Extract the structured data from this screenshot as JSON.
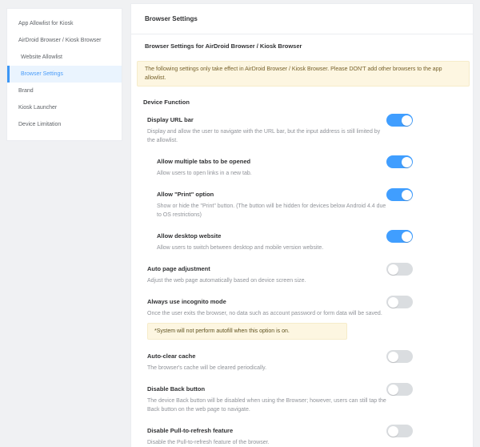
{
  "colors": {
    "page_background": "#f0f1f3",
    "accent_blue": "#409eff",
    "sidebar_selected_text": "#4a9cf8",
    "sidebar_selected_bg": "#eaf4fe",
    "toggle_on": "#409eff",
    "toggle_off": "#dadde0",
    "warning_bg": "#fdf6e1",
    "warning_text": "#77622c",
    "title_text": "#303133",
    "description_text": "#909399"
  },
  "sidebar": {
    "items": [
      {
        "label": "App Allowlist for Kiosk",
        "selected": false
      },
      {
        "label": "AirDroid Browser / Kiosk Browser",
        "selected": false
      },
      {
        "label": "Website Allowlist",
        "selected": false
      },
      {
        "label": "Browser Settings",
        "selected": true
      },
      {
        "label": "Brand",
        "selected": false
      },
      {
        "label": "Kiosk Launcher",
        "selected": false
      },
      {
        "label": "Device Limitation",
        "selected": false
      }
    ]
  },
  "main": {
    "header_title": "Browser Settings",
    "section_title": "Browser Settings for AirDroid Browser / Kiosk Browser",
    "warning_banner": "The following settings only take effect in AirDroid Browser / Kiosk Browser. Please DON'T add other browsers to the app allowlist.",
    "group_title": "Device Function",
    "settings": [
      {
        "title": "Display URL bar",
        "description": "Display and allow the user to navigate with the URL bar, but the input address is still limited by the allowlist.",
        "state": "on"
      },
      {
        "title": "Allow multiple tabs to be opened",
        "description": "Allow users to open links in a new tab.",
        "state": "on"
      },
      {
        "title": "Allow \"Print\" option",
        "description": "Show or hide the \"Print\" button. (The button will be hidden for devices below Android 4.4 due to OS restrictions)",
        "state": "on"
      },
      {
        "title": "Allow desktop website",
        "description": "Allow users to switch between desktop and mobile version website.",
        "state": "on"
      },
      {
        "title": "Auto page adjustment",
        "description": "Adjust the web page automatically based on device screen size.",
        "state": "off"
      },
      {
        "title": "Always use incognito mode",
        "description": "Once the user exits the browser, no data such as account password or form data will be saved.",
        "note": "*System will not perform autofill when this option is on.",
        "state": "off"
      },
      {
        "title": "Auto-clear cache",
        "description": "The browser's cache will be cleared periodically.",
        "state": "off"
      },
      {
        "title": "Disable Back button",
        "description": "The device Back button will be disabled when using the Browser; however, users can still tap the Back button on the web page to navigate.",
        "state": "off"
      },
      {
        "title": "Disable Pull-to-refresh feature",
        "description": "Disable the Pull-to-refresh feature of the browser.",
        "state": "off"
      }
    ]
  }
}
